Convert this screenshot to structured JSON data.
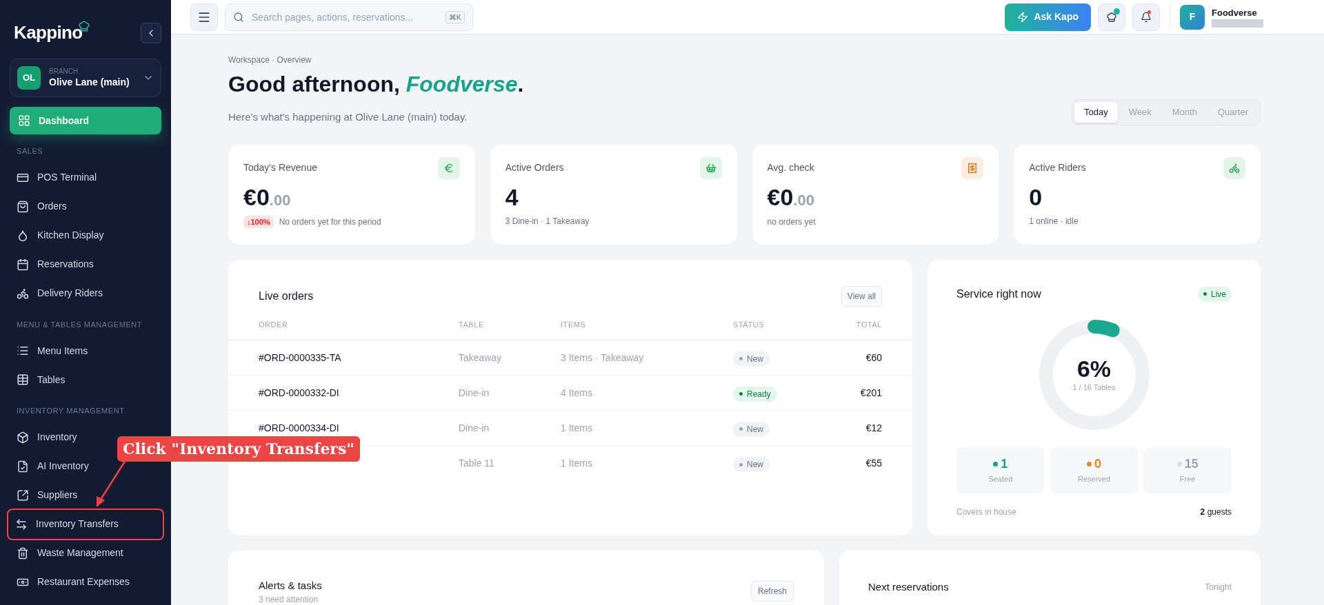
{
  "sidebar": {
    "logo": "Kappino",
    "branch": {
      "initials": "OL",
      "caption": "BRANCH",
      "name": "Olive Lane (main)"
    },
    "dashboard": {
      "label": "Dashboard",
      "selected": true
    },
    "sections": [
      {
        "heading": "SALES",
        "items": [
          {
            "label": "POS Terminal",
            "selected": false,
            "annotated": false
          },
          {
            "label": "Orders",
            "selected": false,
            "annotated": false
          },
          {
            "label": "Kitchen Display",
            "selected": false,
            "annotated": false
          },
          {
            "label": "Reservations",
            "selected": false,
            "annotated": false
          },
          {
            "label": "Delivery Riders",
            "selected": false,
            "annotated": false
          }
        ]
      },
      {
        "heading": "MENU & TABLES MANAGEMENT",
        "items": [
          {
            "label": "Menu Items",
            "selected": false,
            "annotated": false
          },
          {
            "label": "Tables",
            "selected": false,
            "annotated": false
          }
        ]
      },
      {
        "heading": "INVENTORY MANAGEMENT",
        "items": [
          {
            "label": "Inventory",
            "selected": false,
            "annotated": false
          },
          {
            "label": "AI Inventory",
            "selected": false,
            "annotated": false
          },
          {
            "label": "Suppliers",
            "selected": false,
            "annotated": false
          },
          {
            "label": "Inventory Transfers",
            "selected": false,
            "annotated": true
          },
          {
            "label": "Waste Management",
            "selected": false,
            "annotated": false
          },
          {
            "label": "Restaurant Expenses",
            "selected": false,
            "annotated": false
          }
        ]
      }
    ]
  },
  "annotation": {
    "label": "Click \"Inventory Transfers\""
  },
  "topbar": {
    "search": {
      "placeholder": "Search pages, actions, reservations...",
      "shortcut": "⌘K"
    },
    "ask_button": "Ask Kapo",
    "notifications_unread": true,
    "user": {
      "initial": "F",
      "name": "Foodverse"
    }
  },
  "header": {
    "breadcrumb": "Workspace · Overview",
    "greeting": "Good afternoon, ",
    "name": "Foodverse",
    "punct": ".",
    "subtitle": "Here's what's happening at Olive Lane (main) today.",
    "periods": [
      {
        "label": "Today",
        "selected": true
      },
      {
        "label": "Week",
        "selected": false
      },
      {
        "label": "Month",
        "selected": false
      },
      {
        "label": "Quarter",
        "selected": false
      }
    ]
  },
  "stats": [
    {
      "title": "Today's Revenue",
      "value": "€0",
      "decimals": ".00",
      "badge": "↓100%",
      "note": "No orders yet for this period",
      "color": "#16a34a"
    },
    {
      "title": "Active Orders",
      "value": "4",
      "note": "3 Dine-in · 1 Takeaway",
      "color": "#16a34a"
    },
    {
      "title": "Avg. check",
      "value": "€0",
      "decimals": ".00",
      "note": "no orders yet",
      "color": "#d97706"
    },
    {
      "title": "Active Riders",
      "value": "0",
      "note": "1 online · idle",
      "color": "#16a34a"
    }
  ],
  "live_orders": {
    "title": "Live orders",
    "button": "View all",
    "columns": [
      "ORDER",
      "TABLE",
      "ITEMS",
      "STATUS",
      "TOTAL"
    ],
    "rows": [
      {
        "order": "#ORD-0000335-TA",
        "table": "Takeaway",
        "items": "3 Items · Takeaway",
        "status": "New",
        "kind": "new",
        "total": "€60"
      },
      {
        "order": "#ORD-0000332-DI",
        "table": "Dine-in",
        "items": "4 Items",
        "status": "Ready",
        "kind": "ready",
        "total": "€201"
      },
      {
        "order": "#ORD-0000334-DI",
        "table": "Dine-in",
        "items": "1 Items",
        "status": "New",
        "kind": "new",
        "total": "€12"
      },
      {
        "table": "Table 11",
        "items": "1 Items",
        "status": "New",
        "kind": "new",
        "total": "€55"
      }
    ]
  },
  "service": {
    "title": "Service right now",
    "badge": "Live",
    "percent": "6%",
    "level": 0.0625,
    "caption": "1 / 16 Tables",
    "stats": [
      {
        "value": "1",
        "label": "Seated",
        "color": "#14a38b"
      },
      {
        "value": "0",
        "label": "Reserved",
        "color": "#e08a2e"
      },
      {
        "value": "15",
        "label": "Free",
        "color": "#d9dce1"
      }
    ],
    "covers_label": "Covers in house",
    "covers_value": "2",
    "covers_unit": " guests"
  },
  "alerts": {
    "title": "Alerts & tasks",
    "subtitle": "3 need attention",
    "button": "Refresh"
  },
  "reservations": {
    "title": "Next reservations",
    "note": "Tonight"
  }
}
